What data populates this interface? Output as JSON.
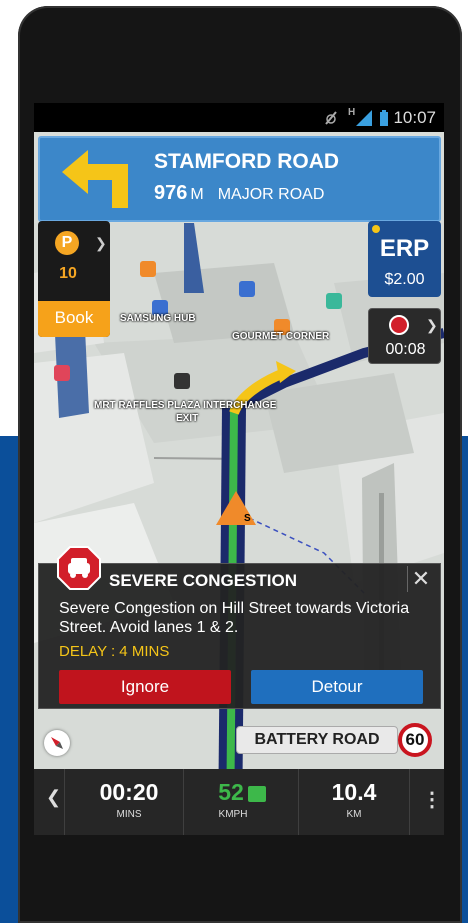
{
  "status_bar": {
    "time": "10:07",
    "signal_label": "H"
  },
  "instruction": {
    "street": "STAMFORD ROAD",
    "distance_value": "976",
    "distance_unit": "M",
    "road_type": "MAJOR ROAD"
  },
  "parking": {
    "icon_letter": "P",
    "count": "10",
    "book_label": "Book"
  },
  "erp": {
    "label": "ERP",
    "price": "$2.00"
  },
  "timer": {
    "value": "00:08"
  },
  "map_labels": {
    "samsung": "SAMSUNG HUB",
    "gourmet": "GOURMET CORNER",
    "mrt_line1": "MRT RAFFLES PLAZA INTERCHANGE",
    "mrt_line2": "EXIT"
  },
  "alert": {
    "title": "SEVERE CONGESTION",
    "body": "Severe Congestion on Hill Street towards Victoria Street. Avoid lanes 1 & 2.",
    "delay": "DELAY : 4 MINS",
    "ignore_label": "Ignore",
    "detour_label": "Detour"
  },
  "road_sign": {
    "current_road": "BATTERY ROAD",
    "speed_limit": "60"
  },
  "bottom_bar": {
    "time_value": "00:20",
    "time_unit": "MINS",
    "speed_value": "52",
    "speed_unit": "KMPH",
    "distance_value": "10.4",
    "distance_unit": "KM"
  },
  "colors": {
    "accent_blue": "#3c87c9",
    "alert_red": "#c0141d",
    "detour_blue": "#1f6fbe",
    "speed_green": "#3db84a",
    "parking_orange": "#f6a21a"
  },
  "icons": [
    "location-arrow-icon",
    "mute-icon",
    "signal-icon",
    "battery-icon",
    "turn-left-icon",
    "parking-icon",
    "timer-icon",
    "congestion-car-icon",
    "close-icon",
    "compass-icon",
    "leaf-icon",
    "more-icon"
  ]
}
